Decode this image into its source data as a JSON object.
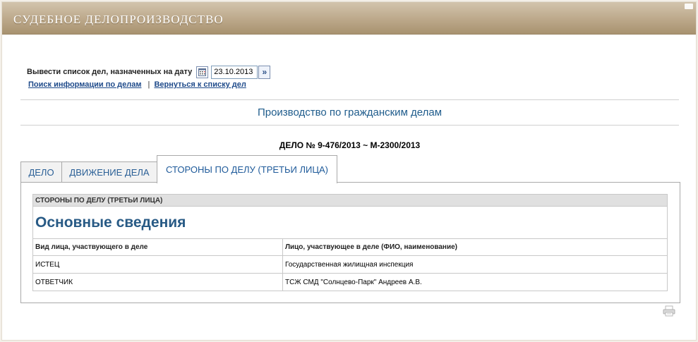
{
  "header": {
    "title": "СУДЕБНОЕ ДЕЛОПРОИЗВОДСТВО"
  },
  "date_filter": {
    "label": "Вывести список дел, назначенных на дату",
    "value": "23.10.2013"
  },
  "links": {
    "search": "Поиск информации по делам",
    "separator": "|",
    "back": "Вернуться к списку дел"
  },
  "section_title": "Производство по гражданским делам",
  "case_number": "ДЕЛО № 9-476/2013 ~ М-2300/2013",
  "tabs": [
    {
      "label": "ДЕЛО",
      "active": false
    },
    {
      "label": "ДВИЖЕНИЕ ДЕЛА",
      "active": false
    },
    {
      "label": "СТОРОНЫ ПО ДЕЛУ (ТРЕТЬИ ЛИЦА)",
      "active": true
    }
  ],
  "panel": {
    "caption": "СТОРОНЫ ПО ДЕЛУ (ТРЕТЬИ ЛИЦА)",
    "heading": "Основные сведения",
    "columns": [
      "Вид лица, участвующего в деле",
      "Лицо, участвующее в деле (ФИО, наименование)"
    ],
    "rows": [
      [
        "ИСТЕЦ",
        "Государственная жилищная инспекция"
      ],
      [
        "ОТВЕТЧИК",
        "ТСЖ СМД \"Солнцево-Парк\" Андреев А.В."
      ]
    ]
  },
  "icons": {
    "calendar": "calendar-icon",
    "go": "double-chevron-right-icon",
    "print": "printer-icon"
  },
  "colors": {
    "header_bg": "#bca88a",
    "link": "#1e4a8a",
    "section_title": "#1f5c8c",
    "heading": "#285a85"
  }
}
